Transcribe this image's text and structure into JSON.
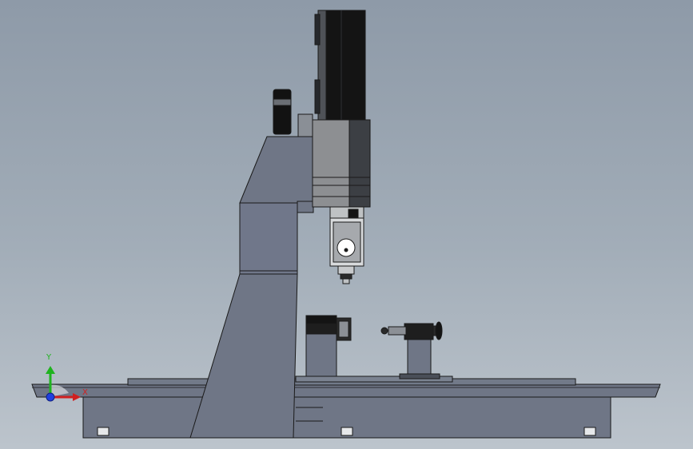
{
  "triad": {
    "y_label": "Y",
    "x_label": "X",
    "colors": {
      "y": "#1fb31f",
      "x": "#d02020",
      "z": "#2040e0"
    }
  },
  "colors": {
    "background_top": "#8e9aa8",
    "background_bottom": "#bcc4cc",
    "machine_body": "#6f7686",
    "machine_dark": "#3c4048",
    "outline": "#1a1a1a"
  }
}
